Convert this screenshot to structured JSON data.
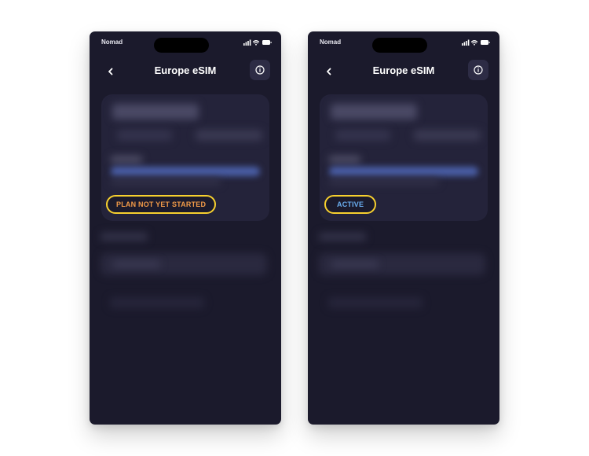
{
  "colors": {
    "screen_bg": "#1b1a2c",
    "card_bg": "#24233a",
    "badge_border": "#f7d02e",
    "badge_not_started_text": "#f19a48",
    "badge_active_text": "#6aaef0"
  },
  "screens": [
    {
      "status_bar": {
        "carrier": "Nomad",
        "icons": [
          "signal-icon",
          "wifi-icon",
          "battery-icon"
        ]
      },
      "nav": {
        "title": "Europe eSIM",
        "back_icon": "chevron-left-icon",
        "info_icon": "info-icon"
      },
      "plan_card": {
        "status_badge": "PLAN NOT YET STARTED"
      }
    },
    {
      "status_bar": {
        "carrier": "Nomad",
        "icons": [
          "signal-icon",
          "wifi-icon",
          "battery-icon"
        ]
      },
      "nav": {
        "title": "Europe eSIM",
        "back_icon": "chevron-left-icon",
        "info_icon": "info-icon"
      },
      "plan_card": {
        "status_badge": "ACTIVE"
      }
    }
  ]
}
